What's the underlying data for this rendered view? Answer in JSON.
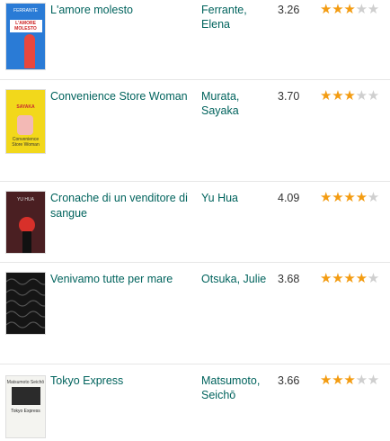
{
  "books": [
    {
      "title": "L'amore molesto",
      "author": "Ferrante, Elena",
      "avg": "3.26",
      "stars": 3,
      "cover": {
        "line1": "FERRANTE",
        "line2": "L'AMORE",
        "line3": "MOLESTO"
      }
    },
    {
      "title": "Convenience Store Woman",
      "author": "Murata, Sayaka",
      "avg": "3.70",
      "stars": 3,
      "cover": {
        "line1": "SAYAKA",
        "line2": "Convenience",
        "line3": "Store Woman"
      }
    },
    {
      "title": "Cronache di un venditore di sangue",
      "author": "Yu Hua",
      "avg": "4.09",
      "stars": 4,
      "cover": {
        "line1": "YU HUA",
        "line2": "",
        "line3": ""
      }
    },
    {
      "title": "Venivamo tutte per mare",
      "author": "Otsuka, Julie",
      "avg": "3.68",
      "stars": 4,
      "cover": {
        "line1": "",
        "line2": "",
        "line3": ""
      }
    },
    {
      "title": "Tokyo Express",
      "author": "Matsumoto, Seichō",
      "avg": "3.66",
      "stars": 3,
      "cover": {
        "line1": "Matsumoto Seichō",
        "line2": "Tokyo Express",
        "line3": ""
      }
    }
  ],
  "colors": {
    "link": "#00635d",
    "star_on": "#f39c12",
    "star_off": "#cfcfcf"
  }
}
